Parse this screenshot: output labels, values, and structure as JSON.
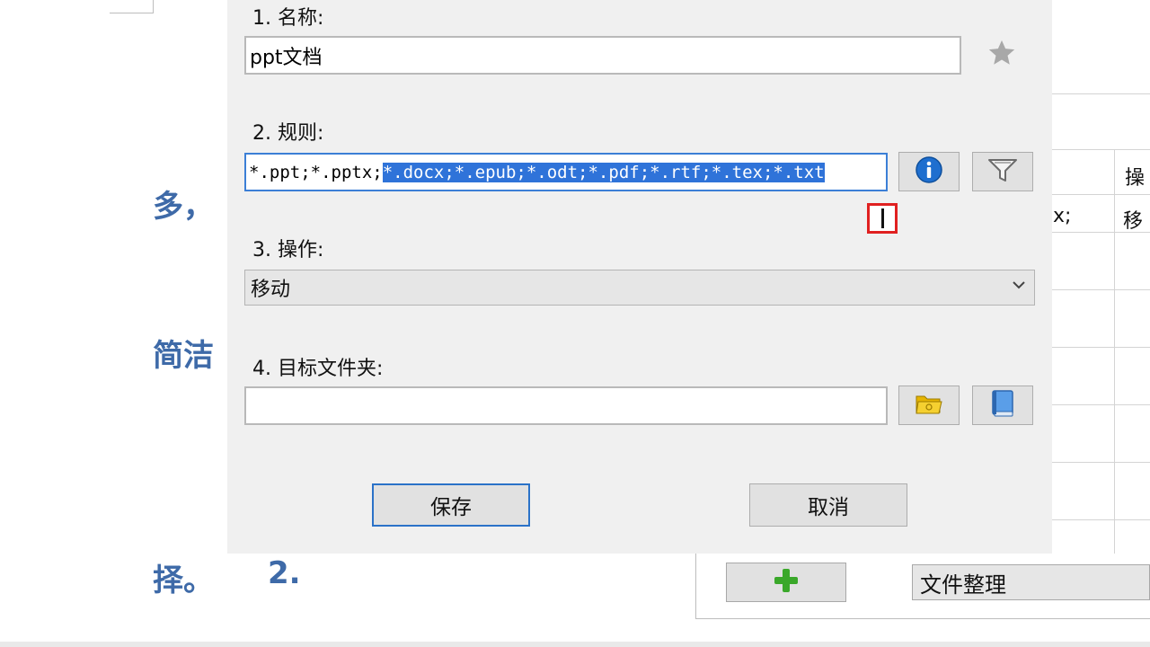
{
  "background": {
    "doc_texts": [
      "多，",
      "简洁",
      "择。",
      "2."
    ],
    "table": {
      "header_col2": "操",
      "row1_col1": "x;",
      "row1_col2": "移"
    },
    "add_button_icon": "plus-icon",
    "group_select_value": "文件整理"
  },
  "dialog": {
    "name_label": "1. 名称:",
    "name_value": "ppt文档",
    "rule_label": "2. 规则:",
    "rule_value_plain": "*.ppt;*.pptx;",
    "rule_value_selected": "*.docx;*.epub;*.odt;*.pdf;*.rtf;*.tex;*.txt",
    "action_label": "3. 操作:",
    "action_value": "移动",
    "target_label": "4. 目标文件夹:",
    "target_value": "",
    "save_label": "保存",
    "cancel_label": "取消",
    "icons": [
      "star-icon",
      "info-icon",
      "filter-icon",
      "folder-icon",
      "book-icon",
      "chevron-down-icon"
    ],
    "colors": {
      "selection": "#2f73d9",
      "focus_border": "#3c7fd6",
      "highlight_marker": "#e02020"
    }
  }
}
